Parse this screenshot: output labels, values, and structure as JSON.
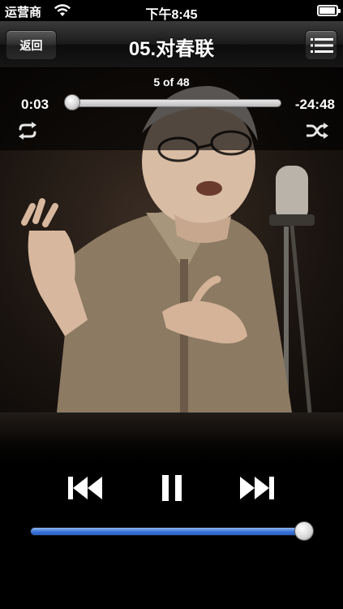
{
  "status_bar": {
    "carrier": "运营商",
    "time": "下午8:45",
    "battery_level": 0.95,
    "wifi_icon": "wifi-icon"
  },
  "nav": {
    "back_label": "返回",
    "title": "05.对春联",
    "list_icon": "list-icon"
  },
  "player": {
    "track_position": "5 of 48",
    "elapsed": "0:03",
    "remaining": "-24:48",
    "progress": 0.002,
    "repeat_icon": "repeat-icon",
    "shuffle_icon": "shuffle-icon",
    "prev_icon": "previous-track-icon",
    "pause_icon": "pause-icon",
    "next_icon": "next-track-icon",
    "volume": 1.0
  },
  "colors": {
    "volume_fill": "#3a73d8",
    "nav_bg": "#1a1a1a"
  }
}
